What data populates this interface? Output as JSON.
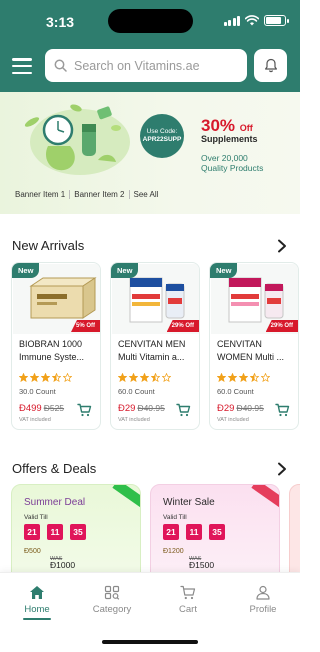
{
  "status_bar": {
    "time": "3:13"
  },
  "header": {
    "search_placeholder": "Search on Vitamins.ae",
    "icons": {
      "menu": "hamburger-icon",
      "search": "search-icon",
      "notifications": "bell-icon"
    }
  },
  "banner": {
    "use_code_label": "Use Code:",
    "code": "APR22SUPP",
    "discount": "30%",
    "discount_suffix": "Off",
    "discount_subject": "Supplements",
    "quantity_line1": "Over 20,000",
    "quantity_line2": "Quality Products",
    "tabs": [
      "Banner Item 1",
      "Banner Item 2",
      "See All"
    ]
  },
  "new_arrivals": {
    "title": "New Arrivals",
    "products": [
      {
        "badge": "New",
        "off": "5% Off",
        "name": "BIOBRAN 1000 Immune Syste...",
        "rating": 3.5,
        "count": "30.0 Count",
        "price": "Ð499",
        "old_price": "Ð525",
        "vat": "VAT included"
      },
      {
        "badge": "New",
        "off": "29% Off",
        "name": "CENVITAN MEN Multi Vitamin a...",
        "rating": 3.5,
        "count": "60.0 Count",
        "price": "Ð29",
        "old_price": "Ð40.95",
        "vat": "VAT included"
      },
      {
        "badge": "New",
        "off": "29% Off",
        "name": "CENVITAN WOMEN Multi ...",
        "rating": 3.5,
        "count": "60.0 Count",
        "price": "Ð29",
        "old_price": "Ð40.95",
        "vat": "VAT included"
      }
    ]
  },
  "offers": {
    "title": "Offers & Deals",
    "items": [
      {
        "title": "Summer Deal",
        "valid_label": "Valid Till",
        "timer": [
          "21",
          "11",
          "35"
        ],
        "new_price": "Ð500",
        "old_price": "WAS",
        "now_price": "Ð1000",
        "accent": "#2fbf4a"
      },
      {
        "title": "Winter Sale",
        "valid_label": "Valid Till",
        "timer": [
          "21",
          "11",
          "35"
        ],
        "new_price": "Ð1200",
        "old_price": "WAS",
        "now_price": "Ð1500",
        "accent": "#e53d5c"
      }
    ]
  },
  "bottom_nav": {
    "items": [
      {
        "label": "Home",
        "icon": "home-icon",
        "active": true
      },
      {
        "label": "Category",
        "icon": "category-icon",
        "active": false
      },
      {
        "label": "Cart",
        "icon": "cart-icon",
        "active": false
      },
      {
        "label": "Profile",
        "icon": "profile-icon",
        "active": false
      }
    ]
  },
  "colors": {
    "brand": "#2e7d6e",
    "sale_red": "#d7192b",
    "star": "#f1a11a"
  }
}
